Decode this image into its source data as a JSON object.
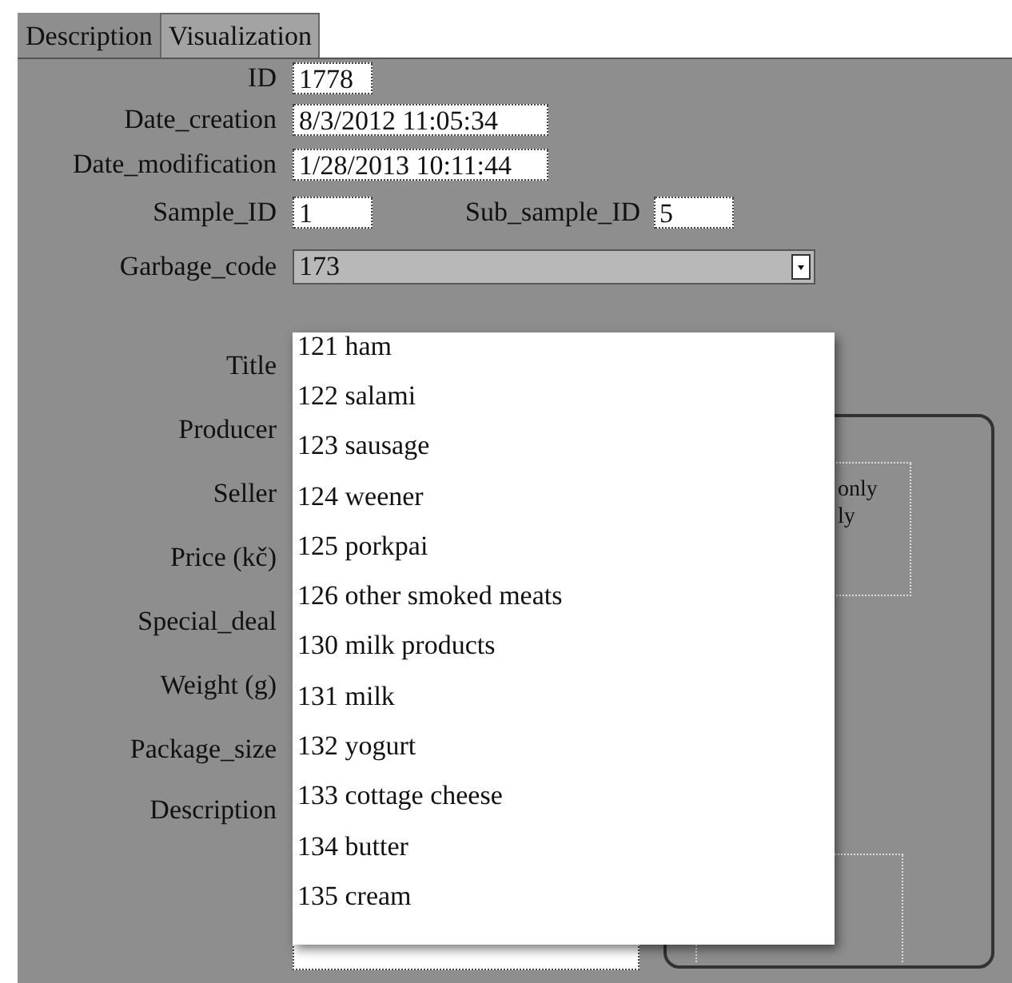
{
  "tabs": [
    {
      "label": "Description",
      "selected": true
    },
    {
      "label": "Visualization",
      "selected": false
    }
  ],
  "fields_top": [
    {
      "label": "ID",
      "value": "1778"
    },
    {
      "label": "Date_creation",
      "value": "8/3/2012 11:05:34"
    },
    {
      "label": "Date_modification",
      "value": "1/28/2013 10:11:44"
    }
  ],
  "sample_row": [
    {
      "label": "Sample_ID",
      "value": "1"
    },
    {
      "label": "Sub_sample_ID",
      "value": "5"
    }
  ],
  "garbage_code": {
    "label": "Garbage_code",
    "value": "173",
    "expanded": true,
    "options": [
      "121 ham",
      "122 salami",
      "123 sausage",
      "124 weener",
      "125 porkpai",
      "126 other smoked meats",
      "130 milk products",
      "131 milk",
      "132 yogurt",
      "133 cottage cheese",
      "134 butter",
      "135 cream"
    ]
  },
  "lower_labels": [
    "Title",
    "Producer",
    "Seller",
    "Price (kč)",
    "Special_deal",
    "Weight (g)",
    "Package_size",
    "Description"
  ],
  "side_panel": {
    "note_lines": [
      "only",
      "ly"
    ]
  }
}
